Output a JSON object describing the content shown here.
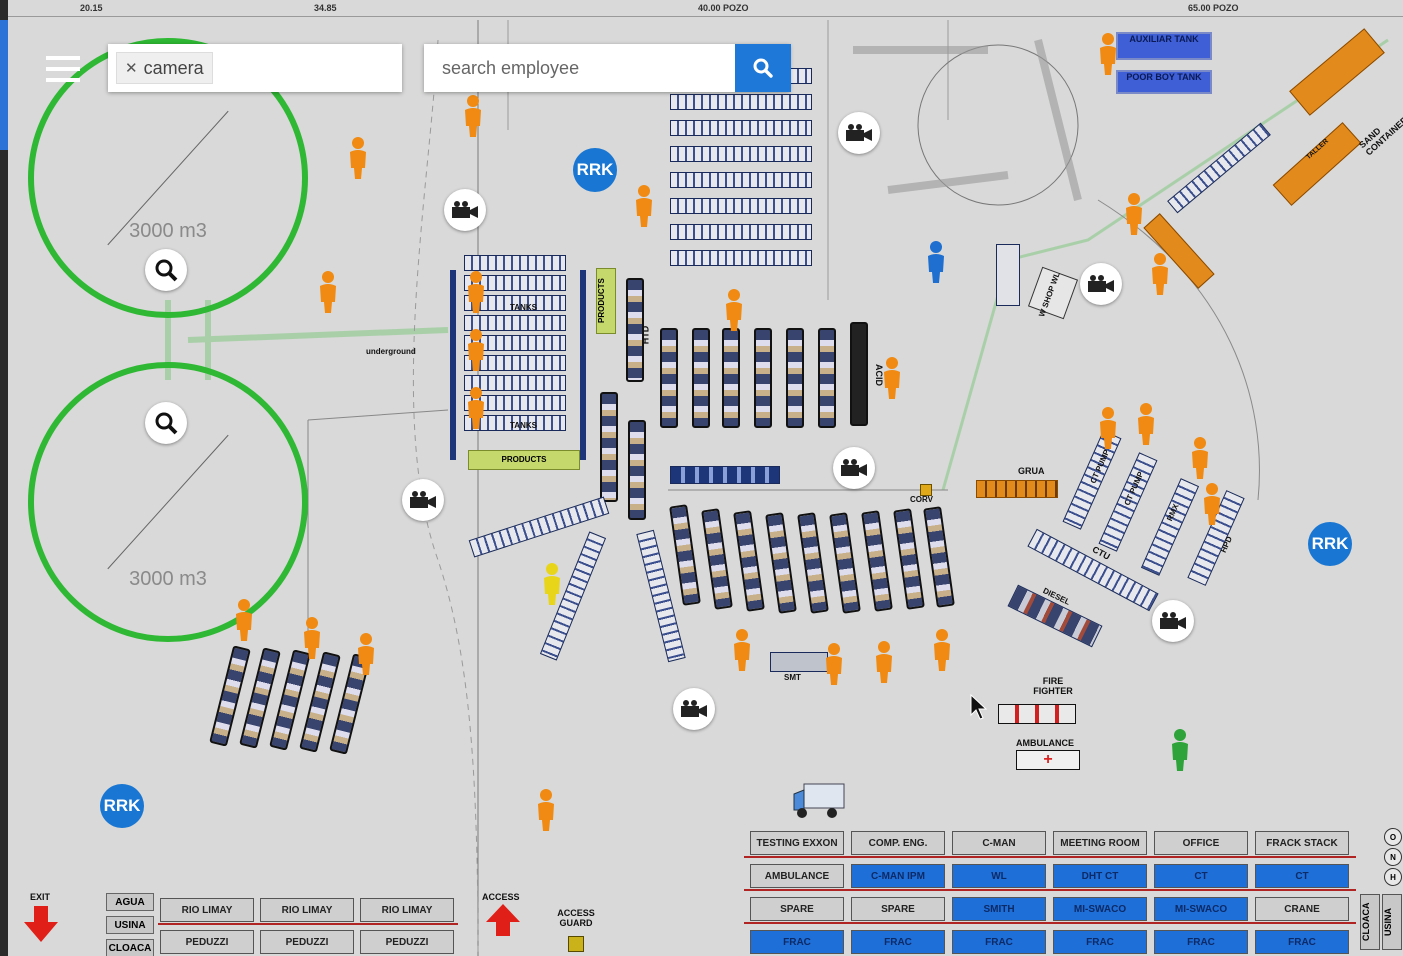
{
  "search": {
    "filter_chip": "camera",
    "employee_placeholder": "search employee"
  },
  "ruler": {
    "labels": [
      "20.15",
      "34.85",
      "40.00 POZO",
      "65.00 POZO"
    ]
  },
  "tanks": [
    {
      "capacity": "3000 m3"
    },
    {
      "capacity": "3000 m3"
    }
  ],
  "badges": {
    "rrk": "RRK"
  },
  "site_labels": {
    "underground": "underground",
    "tanks_top": "TANKS",
    "tanks_bottom": "TANKS",
    "products_bottom": "PRODUCTS",
    "products_side": "PRODUCTS",
    "htd": "HTD",
    "acid": "ACID",
    "auxiliar_tank": "AUXILIAR TANK",
    "poor_boy_tank": "POOR BOY TANK",
    "sand_container": "SAND CONTAINER",
    "taller": "TALLER",
    "wl_shop": "W SHOP WL",
    "wl": "WL",
    "grua": "GRUA",
    "corv": "CORV",
    "ct_pump_1": "CT PUMP",
    "ct_pump_2": "CT PUMP",
    "rmx": "RMX",
    "hpd": "HPD",
    "ctu": "CTU",
    "diesel": "DIESEL",
    "smt": "SMT",
    "fire_fighter": "FIRE FIGHTER",
    "ambulance": "AMBULANCE",
    "exit": "EXIT",
    "access": "ACCESS",
    "access_guard": "ACCESS GUARD",
    "cloaca_v": "CLOACA",
    "usina_v": "USINA"
  },
  "bottom_left": {
    "small": [
      "AGUA",
      "USINA",
      "CLOACA"
    ],
    "rows": [
      [
        "RIO LIMAY",
        "RIO LIMAY",
        "RIO LIMAY"
      ],
      [
        "PEDUZZI",
        "PEDUZZI",
        "PEDUZZI"
      ]
    ]
  },
  "camp_grid": {
    "rows": [
      [
        {
          "t": "TESTING EXXON",
          "c": "gray"
        },
        {
          "t": "COMP. ENG.",
          "c": "gray"
        },
        {
          "t": "C-MAN",
          "c": "gray"
        },
        {
          "t": "MEETING ROOM",
          "c": "gray"
        },
        {
          "t": "OFFICE",
          "c": "gray"
        },
        {
          "t": "FRACK STACK",
          "c": "gray"
        }
      ],
      [
        {
          "t": "AMBULANCE",
          "c": "gray"
        },
        {
          "t": "C-MAN IPM",
          "c": "blue"
        },
        {
          "t": "WL",
          "c": "blue"
        },
        {
          "t": "DHT CT",
          "c": "blue"
        },
        {
          "t": "CT",
          "c": "blue"
        },
        {
          "t": "CT",
          "c": "blue"
        }
      ],
      [
        {
          "t": "SPARE",
          "c": "gray"
        },
        {
          "t": "SPARE",
          "c": "gray"
        },
        {
          "t": "SMITH",
          "c": "blue"
        },
        {
          "t": "MI-SWACO",
          "c": "blue"
        },
        {
          "t": "MI-SWACO",
          "c": "blue"
        },
        {
          "t": "CRANE",
          "c": "gray"
        }
      ],
      [
        {
          "t": "FRAC",
          "c": "blue"
        },
        {
          "t": "FRAC",
          "c": "blue"
        },
        {
          "t": "FRAC",
          "c": "blue"
        },
        {
          "t": "FRAC",
          "c": "blue"
        },
        {
          "t": "FRAC",
          "c": "blue"
        },
        {
          "t": "FRAC",
          "c": "blue"
        }
      ]
    ]
  },
  "side_buttons": [
    "O",
    "N",
    "H"
  ],
  "colors": {
    "map_bg": "#d8d9d8",
    "tank_ring": "#2eb833",
    "accent_blue": "#1e78d8",
    "person_orange": "#f08a12",
    "person_blue": "#1e6fd0",
    "person_yellow": "#e8d51a",
    "person_green": "#2ea33a"
  }
}
